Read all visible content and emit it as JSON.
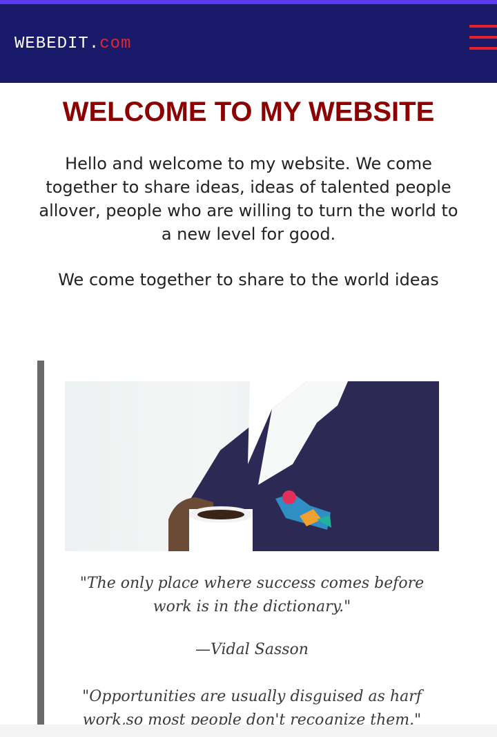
{
  "header": {
    "logo_main": "WEBEDIT.",
    "logo_tld": "com",
    "menu_icon": "hamburger-menu-icon",
    "colors": {
      "strip": "#5b3bf0",
      "background": "#1a1a6b",
      "logo": "#ffffff",
      "tld": "#e0282b",
      "menu": "#e8202a"
    }
  },
  "main": {
    "title": "WELCOME TO MY WEBSITE",
    "intro": "Hello and welcome to my website. We come together to share ideas, ideas of talented people allover, people who are willing to turn the world to a new level for good.",
    "tagline": "We come together to share to the world ideas",
    "title_color": "#8b0000"
  },
  "quotes": {
    "quote1": "\"The only place where success comes before work is in the dictionary.\"",
    "author1": "—Vidal Sasson",
    "quote2": "\"Opportunities are usually disguised as harf work,so most people don't recognize them.\"",
    "border_color": "#6a6a6a"
  }
}
